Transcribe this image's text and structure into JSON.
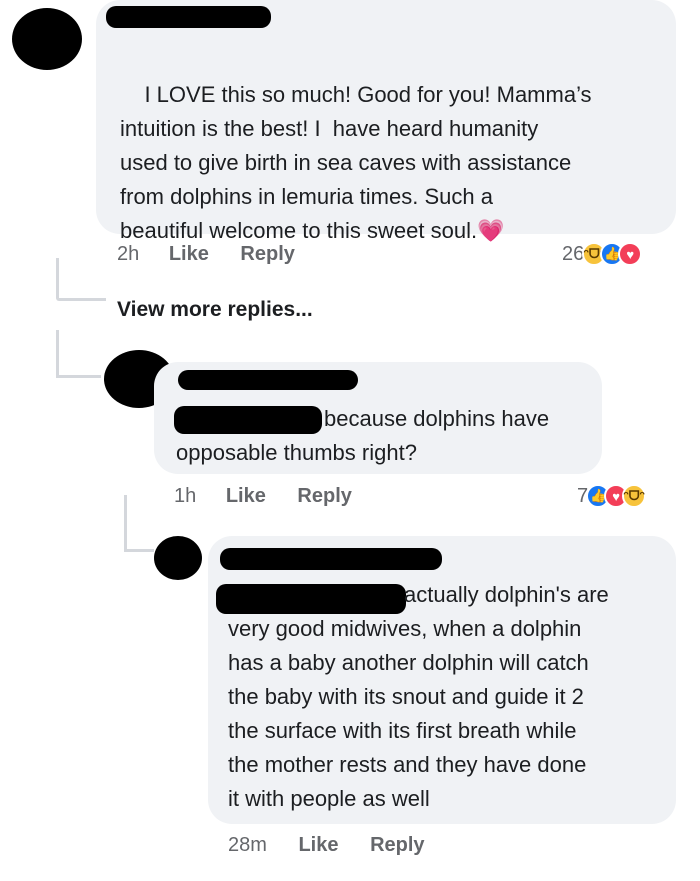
{
  "comments": [
    {
      "text": "I LOVE this so much! Good for you! Mamma’s\nintuition is the best! I  have heard humanity\nused to give birth in sea caves with assistance\nfrom dolphins in lemuria times. Such a\nbeautiful welcome to this sweet soul.",
      "emoji": "💗",
      "time": "2h",
      "like_label": "Like",
      "reply_label": "Reply",
      "reaction_count": "26",
      "reactions": [
        "haha",
        "like",
        "love"
      ]
    },
    {
      "text": "because dolphins have\nopposable thumbs right?",
      "time": "1h",
      "like_label": "Like",
      "reply_label": "Reply",
      "reaction_count": "7",
      "reactions": [
        "like",
        "love",
        "haha"
      ]
    },
    {
      "text": "actually dolphin's are\nvery good midwives, when a dolphin\nhas a baby another dolphin will catch\nthe baby with its snout and guide it 2\nthe surface with its first breath while\nthe mother rests and they have done\nit with people as well",
      "time": "28m",
      "like_label": "Like",
      "reply_label": "Reply"
    }
  ],
  "view_more_label": "View more replies..."
}
